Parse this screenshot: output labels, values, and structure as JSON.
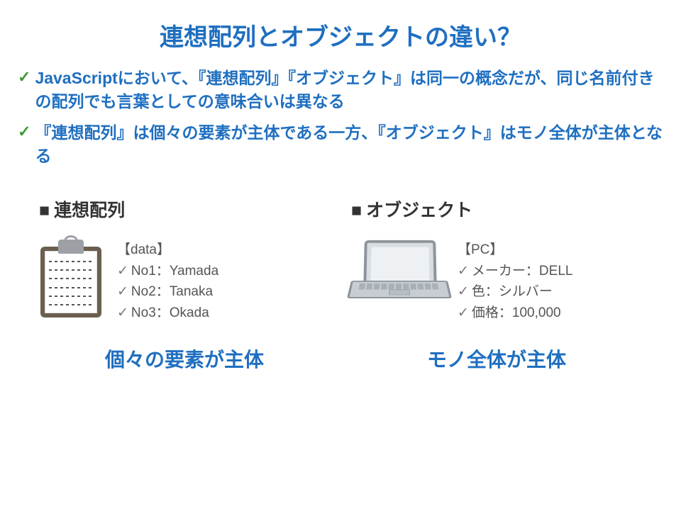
{
  "title": "連想配列とオブジェクトの違い？",
  "bullets": [
    "JavaScriptにおいて、『連想配列』『オブジェクト』は同一の概念だが、同じ名前付きの配列でも言葉としての意味合いは異なる",
    "『連想配列』は個々の要素が主体である一方、『オブジェクト』はモノ全体が主体となる"
  ],
  "left": {
    "heading": "連想配列",
    "label": "【data】",
    "items": [
      "No1：Yamada",
      "No2：Tanaka",
      "No3：Okada"
    ],
    "caption": "個々の要素が主体"
  },
  "right": {
    "heading": "オブジェクト",
    "label": "【PC】",
    "items": [
      "メーカー：DELL",
      "色：シルバー",
      "価格：100,000"
    ],
    "caption": "モノ全体が主体"
  }
}
